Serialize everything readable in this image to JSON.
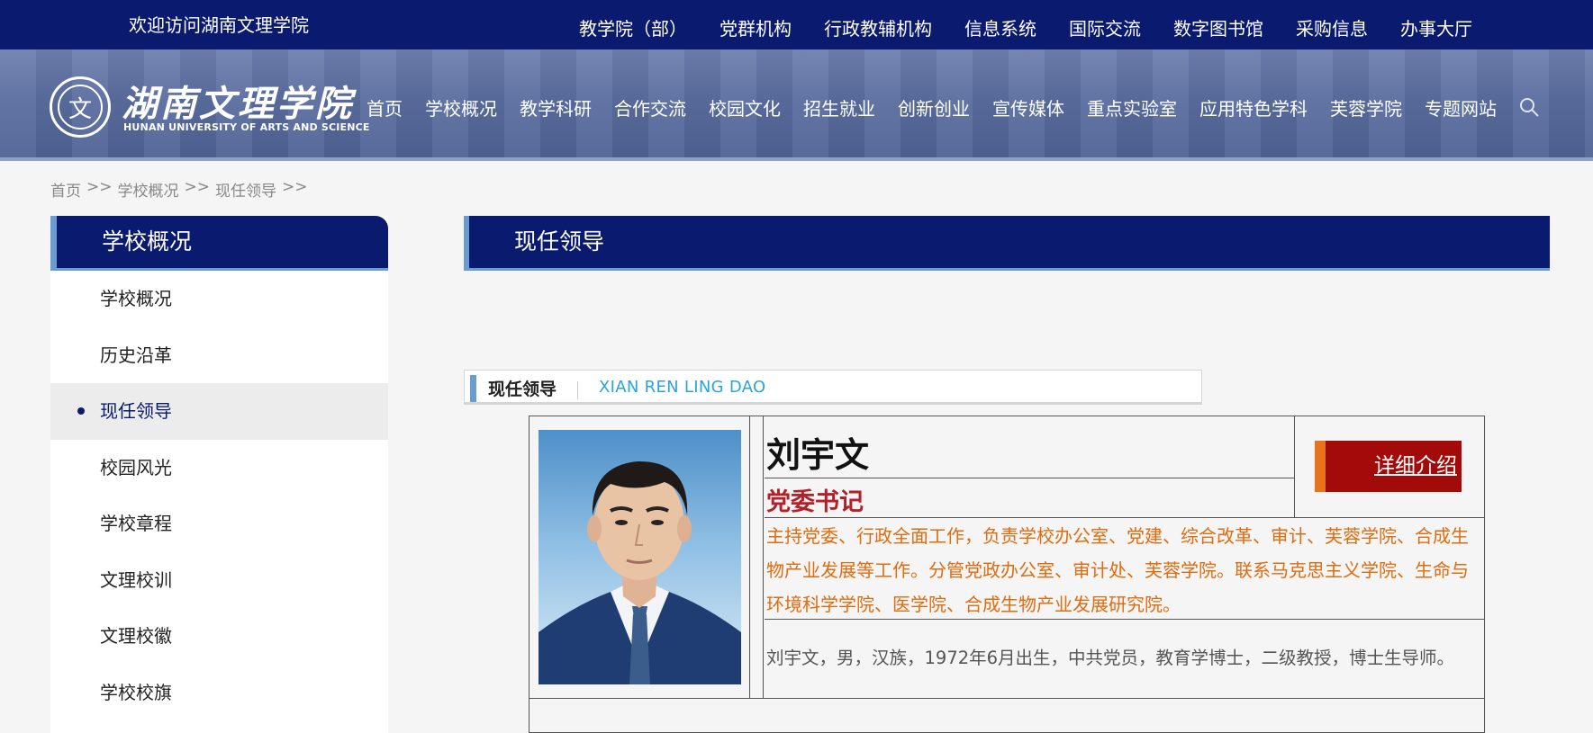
{
  "topbar": {
    "welcome": "欢迎访问湖南文理学院",
    "links": [
      "教学院（部）",
      "党群机构",
      "行政教辅机构",
      "信息系统",
      "国际交流",
      "数字图书馆",
      "采购信息",
      "办事大厅"
    ]
  },
  "header": {
    "logo_cn": "湖南文理学院",
    "logo_en": "HUNAN UNIVERSITY OF ARTS AND SCIENCE",
    "nav": [
      "首页",
      "学校概况",
      "教学科研",
      "合作交流",
      "校园文化",
      "招生就业",
      "创新创业",
      "宣传媒体",
      "重点实验室",
      "应用特色学科",
      "芙蓉学院",
      "专题网站"
    ],
    "search_icon": "search-icon"
  },
  "breadcrumb": [
    "首页",
    ">>",
    "学校概况",
    ">>",
    "现任领导",
    ">>"
  ],
  "sidebar": {
    "title": "学校概况",
    "items": [
      {
        "label": "学校概况"
      },
      {
        "label": "历史沿革"
      },
      {
        "label": "现任领导"
      },
      {
        "label": "校园风光"
      },
      {
        "label": "学校章程"
      },
      {
        "label": "文理校训"
      },
      {
        "label": "文理校徽"
      },
      {
        "label": "学校校旗"
      }
    ]
  },
  "content": {
    "title": "现任领导",
    "section_cn": "现任领导",
    "section_en": "XIAN REN LING DAO"
  },
  "leader": {
    "name": "刘宇文",
    "role": "党委书记",
    "detail_label": "详细介绍",
    "duties": "主持党委、行政全面工作，负责学校办公室、党建、综合改革、审计、芙蓉学院、合成生物产业发展等工作。分管党政办公室、审计处、芙蓉学院。联系马克思主义学院、生命与环境科学学院、医学院、合成生物产业发展研究院。",
    "bio": "刘宇文，男，汉族，1972年6月出生，中共党员，教育学博士，二级教授，博士生导师。"
  },
  "colors": {
    "navy": "#0a1a6e",
    "accent_blue": "#6a9bd1",
    "role_red": "#b4202a",
    "duty_orange": "#e06c10",
    "button_red": "#a30b0b"
  }
}
